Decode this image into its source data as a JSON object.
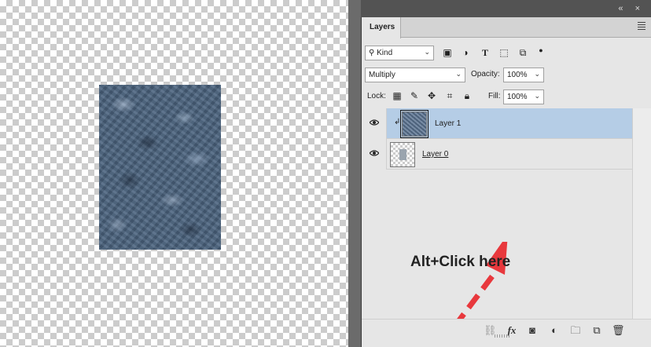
{
  "panel": {
    "title": "Layers",
    "top_icons": "«  ×",
    "filter": {
      "label": "Kind",
      "icon": "search-icon"
    },
    "blend_mode": "Multiply",
    "opacity_label": "Opacity:",
    "opacity_value": "100%",
    "lock_label": "Lock:",
    "fill_label": "Fill:",
    "fill_value": "100%"
  },
  "layers": [
    {
      "name": "Layer 1",
      "selected": true,
      "visible": true,
      "clipped": true
    },
    {
      "name": "Layer 0",
      "selected": false,
      "visible": true,
      "clipped": false
    }
  ],
  "annotation": {
    "text": "Alt+Click here",
    "arrow_color": "#e8383d"
  },
  "bottom": {
    "fx_label": "fx"
  },
  "colors": {
    "selected_row": "#b5cde6",
    "panel_bg": "#e6e6e6",
    "chrome": "#535353"
  }
}
